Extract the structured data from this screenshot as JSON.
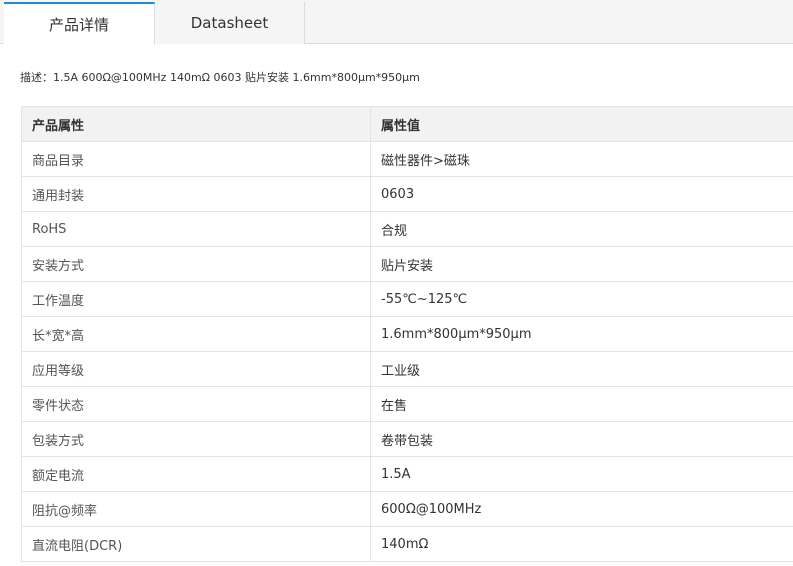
{
  "tabs": [
    {
      "label": "产品详情"
    },
    {
      "label": "Datasheet"
    }
  ],
  "description": "描述：1.5A 600Ω@100MHz 140mΩ 0603 贴片安装 1.6mm*800μm*950μm",
  "table": {
    "headers": [
      "产品属性",
      "属性值"
    ],
    "rows": [
      [
        "商品目录",
        "磁性器件>磁珠"
      ],
      [
        "通用封装",
        "0603"
      ],
      [
        "RoHS",
        "合规"
      ],
      [
        "安装方式",
        "贴片安装"
      ],
      [
        "工作温度",
        "-55℃~125℃"
      ],
      [
        "长*宽*高",
        "1.6mm*800μm*950μm"
      ],
      [
        "应用等级",
        "工业级"
      ],
      [
        "零件状态",
        "在售"
      ],
      [
        "包装方式",
        "卷带包装"
      ],
      [
        "额定电流",
        "1.5A"
      ],
      [
        "阻抗@频率",
        "600Ω@100MHz"
      ],
      [
        "直流电阻(DCR)",
        "140mΩ"
      ]
    ]
  }
}
